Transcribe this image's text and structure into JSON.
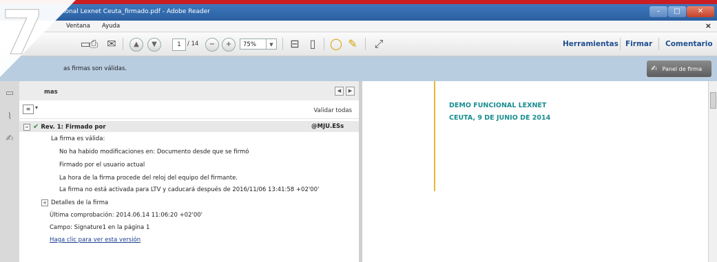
{
  "window": {
    "title": "ional Lexnet Ceuta_firmado.pdf - Adobe Reader",
    "badge_number": "7"
  },
  "menu": {
    "items": [
      "Ventana",
      "Ayuda"
    ],
    "close_glyph": "×"
  },
  "toolbar": {
    "current_page": "1",
    "total_pages": "/ 14",
    "zoom": "75%",
    "right_links": [
      "Herramientas",
      "Firmar",
      "Comentario"
    ]
  },
  "signature_bar": {
    "message": "as firmas son válidas.",
    "panel_button": "Panel de firma"
  },
  "signature_panel": {
    "header_label": "mas",
    "validate_all": "Validar todas",
    "revision": {
      "label": "Rev. 1: Firmado por",
      "signer": "@MJU.ESs"
    },
    "lines": [
      "La firma es válida:",
      "No ha habido modificaciones en: Documento desde que se firmó",
      "Firmado por el usuario actual",
      "La hora de la firma procede del reloj del equipo del firmante.",
      "La firma no está activada para LTV y caducará después de 2016/11/06 13:41:58 +02'00'"
    ],
    "details_label": "Detalles de la firma",
    "last_check": "Última comprobación: 2014.06.14 11:06:20 +02'00'",
    "field": "Campo: Signature1 en la página 1",
    "version_link": "Haga clic para ver esta versión"
  },
  "document": {
    "line1": "DEMO FUNCIONAL LEXNET",
    "line2": "CEUTA, 9 DE JUNIO DE 2014"
  },
  "colors": {
    "accent_red": "#c81e24",
    "title_blue": "#2a5fa0",
    "doc_teal": "#1a8e90",
    "gold_rule": "#e6b832",
    "link_blue": "#1f4f8f"
  }
}
